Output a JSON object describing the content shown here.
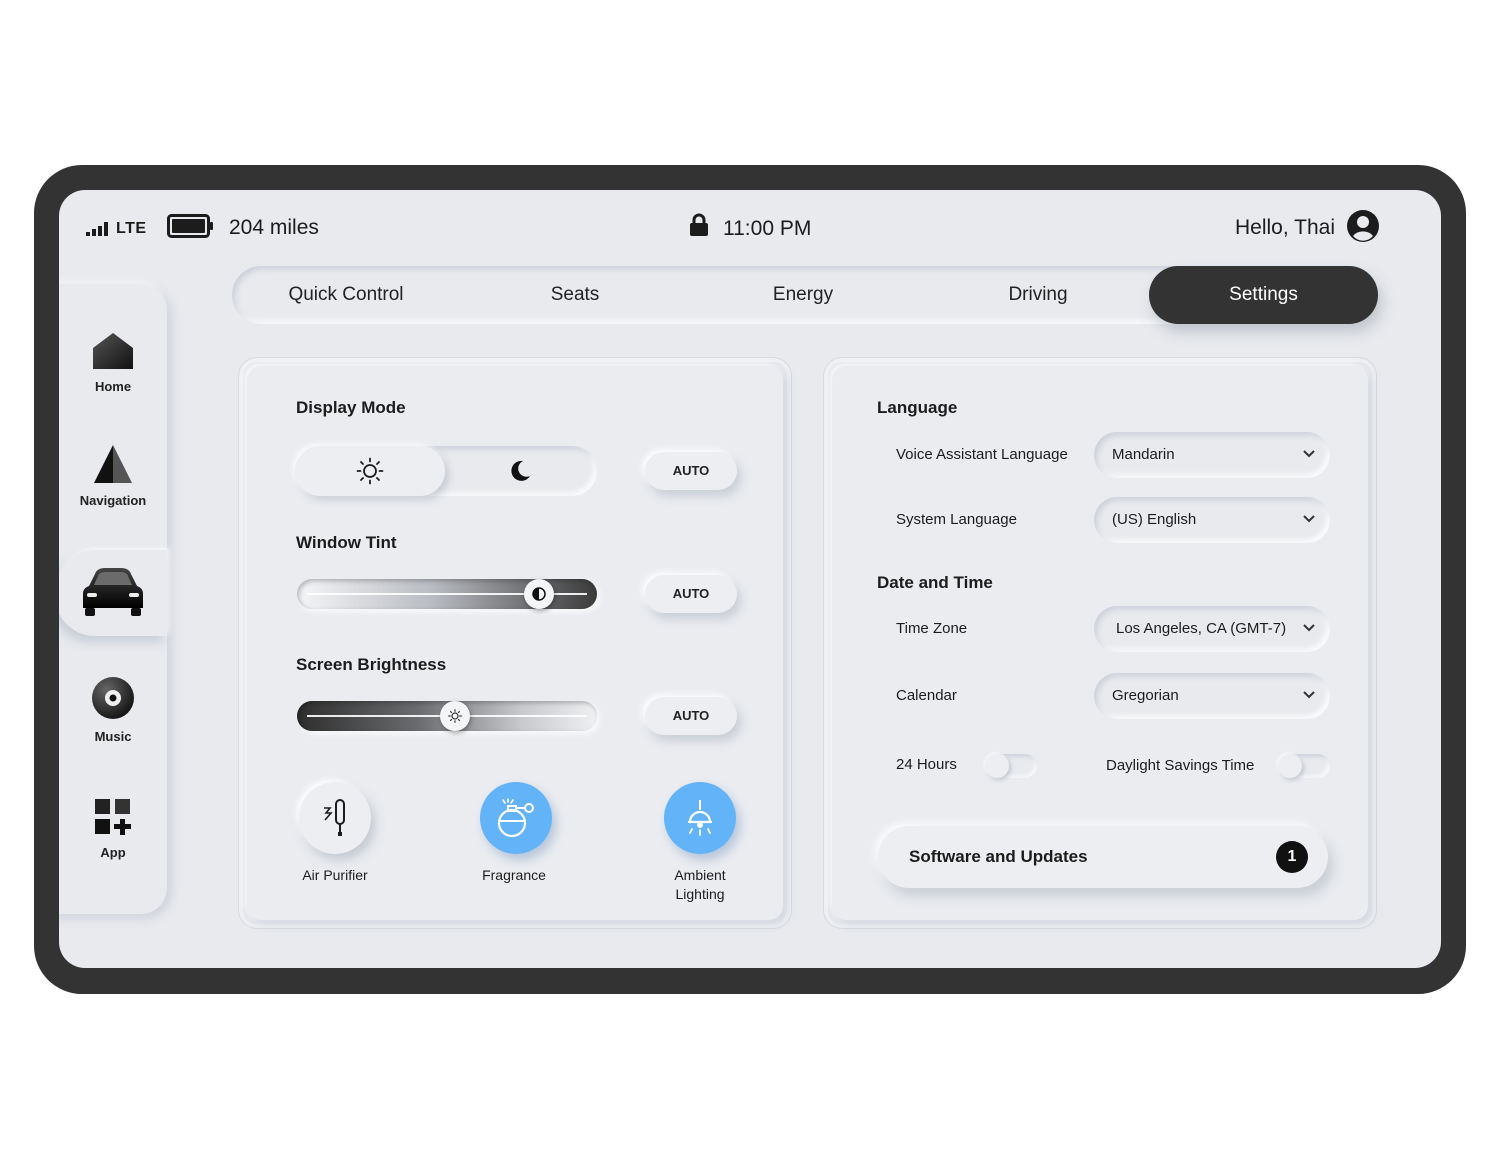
{
  "status": {
    "network": "LTE",
    "range": "204 miles",
    "time": "11:00 PM",
    "greeting": "Hello, Thai"
  },
  "tabs": [
    {
      "label": "Quick Control"
    },
    {
      "label": "Seats"
    },
    {
      "label": "Energy"
    },
    {
      "label": "Driving"
    },
    {
      "label": "Settings",
      "active": true
    }
  ],
  "sidebar": {
    "items": [
      {
        "label": "Home",
        "icon": "home-icon"
      },
      {
        "label": "Navigation",
        "icon": "navigation-icon"
      },
      {
        "label": "",
        "icon": "car-icon",
        "active": true
      },
      {
        "label": "Music",
        "icon": "music-disc-icon"
      },
      {
        "label": "App",
        "icon": "app-grid-icon"
      }
    ]
  },
  "display": {
    "display_mode_title": "Display Mode",
    "display_mode_selected": "light",
    "display_mode_auto": "AUTO",
    "window_tint_title": "Window Tint",
    "window_tint_level": 0.84,
    "window_tint_auto": "AUTO",
    "brightness_title": "Screen Brightness",
    "brightness_level": 0.53,
    "brightness_auto": "AUTO",
    "air_purifier_label": "Air Purifier",
    "fragrance_label": "Fragrance",
    "ambient_lighting_label_1": "Ambient",
    "ambient_lighting_label_2": "Lighting",
    "active_color": "#63b3f8"
  },
  "settings": {
    "language_title": "Language",
    "voice_language_label": "Voice Assistant Language",
    "voice_language_value": "Mandarin",
    "system_language_label": "System Language",
    "system_language_value": "(US) English",
    "datetime_title": "Date and Time",
    "timezone_label": "Time Zone",
    "timezone_value": "Los Angeles, CA (GMT-7)",
    "calendar_label": "Calendar",
    "calendar_value": "Gregorian",
    "hours24_label": "24 Hours",
    "hours24_on": false,
    "dst_label": "Daylight Savings Time",
    "dst_on": false,
    "software_label": "Software and Updates",
    "software_badge": "1"
  }
}
